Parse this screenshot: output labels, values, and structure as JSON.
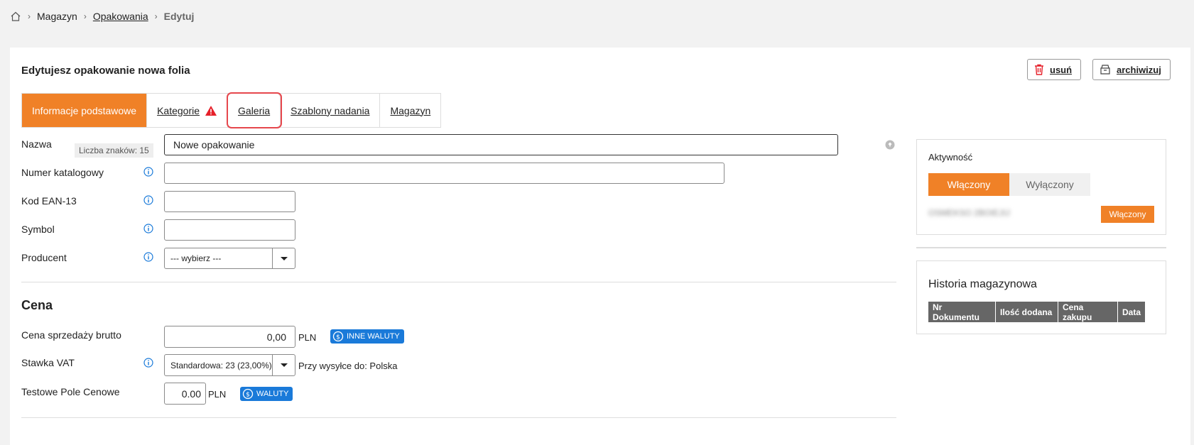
{
  "breadcrumb": {
    "home_icon": "home-icon",
    "items": [
      "Magazyn",
      "Opakowania",
      "Edytuj"
    ]
  },
  "header": {
    "title": "Edytujesz opakowanie nowa folia",
    "delete_label": "usuń",
    "archive_label": "archiwizuj"
  },
  "tabs": [
    {
      "label": "Informacje podstawowe",
      "active": true
    },
    {
      "label": "Kategorie",
      "warning": true
    },
    {
      "label": "Galeria"
    },
    {
      "label": "Szablony nadania"
    },
    {
      "label": "Magazyn"
    }
  ],
  "form": {
    "name_label": "Nazwa",
    "char_count": "Liczba znaków: 15",
    "name_value": "Nowe opakowanie",
    "catalog_label": "Numer katalogowy",
    "catalog_value": "",
    "ean_label": "Kod EAN-13",
    "ean_value": "",
    "symbol_label": "Symbol",
    "symbol_value": "",
    "producer_label": "Producent",
    "producer_value": "--- wybierz ---"
  },
  "price": {
    "section_title": "Cena",
    "gross_label": "Cena sprzedaży brutto",
    "gross_value": "0,00",
    "currency": "PLN",
    "other_currencies_label": "INNE WALUTY",
    "vat_label": "Stawka VAT",
    "vat_value": "Standardowa: 23 (23,00%)",
    "vat_note": "Przy wysyłce do: Polska",
    "test_label": "Testowe Pole Cenowe",
    "test_value": "0.00",
    "test_currency": "PLN",
    "currencies_label": "WALUTY"
  },
  "activity": {
    "title": "Aktywność",
    "on_label": "Włączony",
    "off_label": "Wyłączony",
    "blurred_text": "OSMEKSO 2BOIEJIJ",
    "status_badge": "Włączony"
  },
  "history": {
    "title": "Historia magazynowa",
    "columns": [
      "Nr Dokumentu",
      "Ilość dodana",
      "Cena zakupu",
      "Data"
    ]
  },
  "colors": {
    "accent": "#f08127",
    "link_blue": "#1a7ad9",
    "warning": "#e6202a"
  }
}
